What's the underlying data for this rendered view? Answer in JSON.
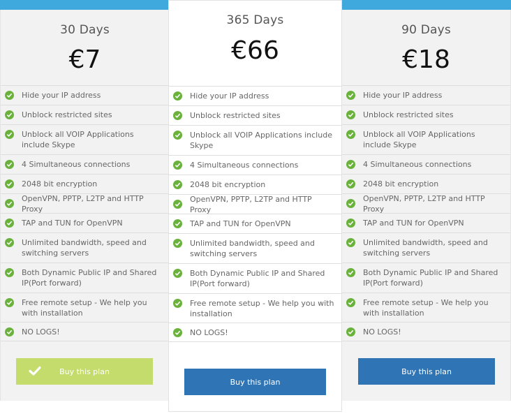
{
  "plans": [
    {
      "title": "30 Days",
      "price": "€7",
      "button_label": "Buy this plan",
      "selected": true,
      "features": [
        "Hide your IP address",
        "Unblock restricted sites",
        "Unblock all VOIP Applications include Skype",
        "4 Simultaneous connections",
        "2048 bit encryption",
        "OpenVPN, PPTP, L2TP and HTTP Proxy",
        "TAP and TUN for OpenVPN",
        "Unlimited bandwidth, speed and switching servers",
        "Both Dynamic Public IP and Shared IP(Port forward)",
        "Free remote setup - We help you with installation",
        "NO LOGS!"
      ]
    },
    {
      "title": "365 Days",
      "price": "€66",
      "button_label": "Buy this plan",
      "selected": false,
      "features": [
        "Hide your IP address",
        "Unblock restricted sites",
        "Unblock all VOIP Applications include Skype",
        "4 Simultaneous connections",
        "2048 bit encryption",
        "OpenVPN, PPTP, L2TP and HTTP Proxy",
        "TAP and TUN for OpenVPN",
        "Unlimited bandwidth, speed and switching servers",
        "Both Dynamic Public IP and Shared IP(Port forward)",
        "Free remote setup - We help you with installation",
        "NO LOGS!"
      ]
    },
    {
      "title": "90 Days",
      "price": "€18",
      "button_label": "Buy this plan",
      "selected": false,
      "features": [
        "Hide your IP address",
        "Unblock restricted sites",
        "Unblock all VOIP Applications include Skype",
        "4 Simultaneous connections",
        "2048 bit encryption",
        "OpenVPN, PPTP, L2TP and HTTP Proxy",
        "TAP and TUN for OpenVPN",
        "Unlimited bandwidth, speed and switching servers",
        "Both Dynamic Public IP and Shared IP(Port forward)",
        "Free remote setup - We help you with installation",
        "NO LOGS!"
      ]
    }
  ],
  "icons": {
    "feature": "check-circle-icon",
    "selected_button": "checkmark-icon"
  },
  "colors": {
    "accent_bar": "#3fa9dd",
    "check_green": "#6ab23c",
    "selected_button": "#c3dc6b",
    "buy_button": "#2f74b5"
  }
}
